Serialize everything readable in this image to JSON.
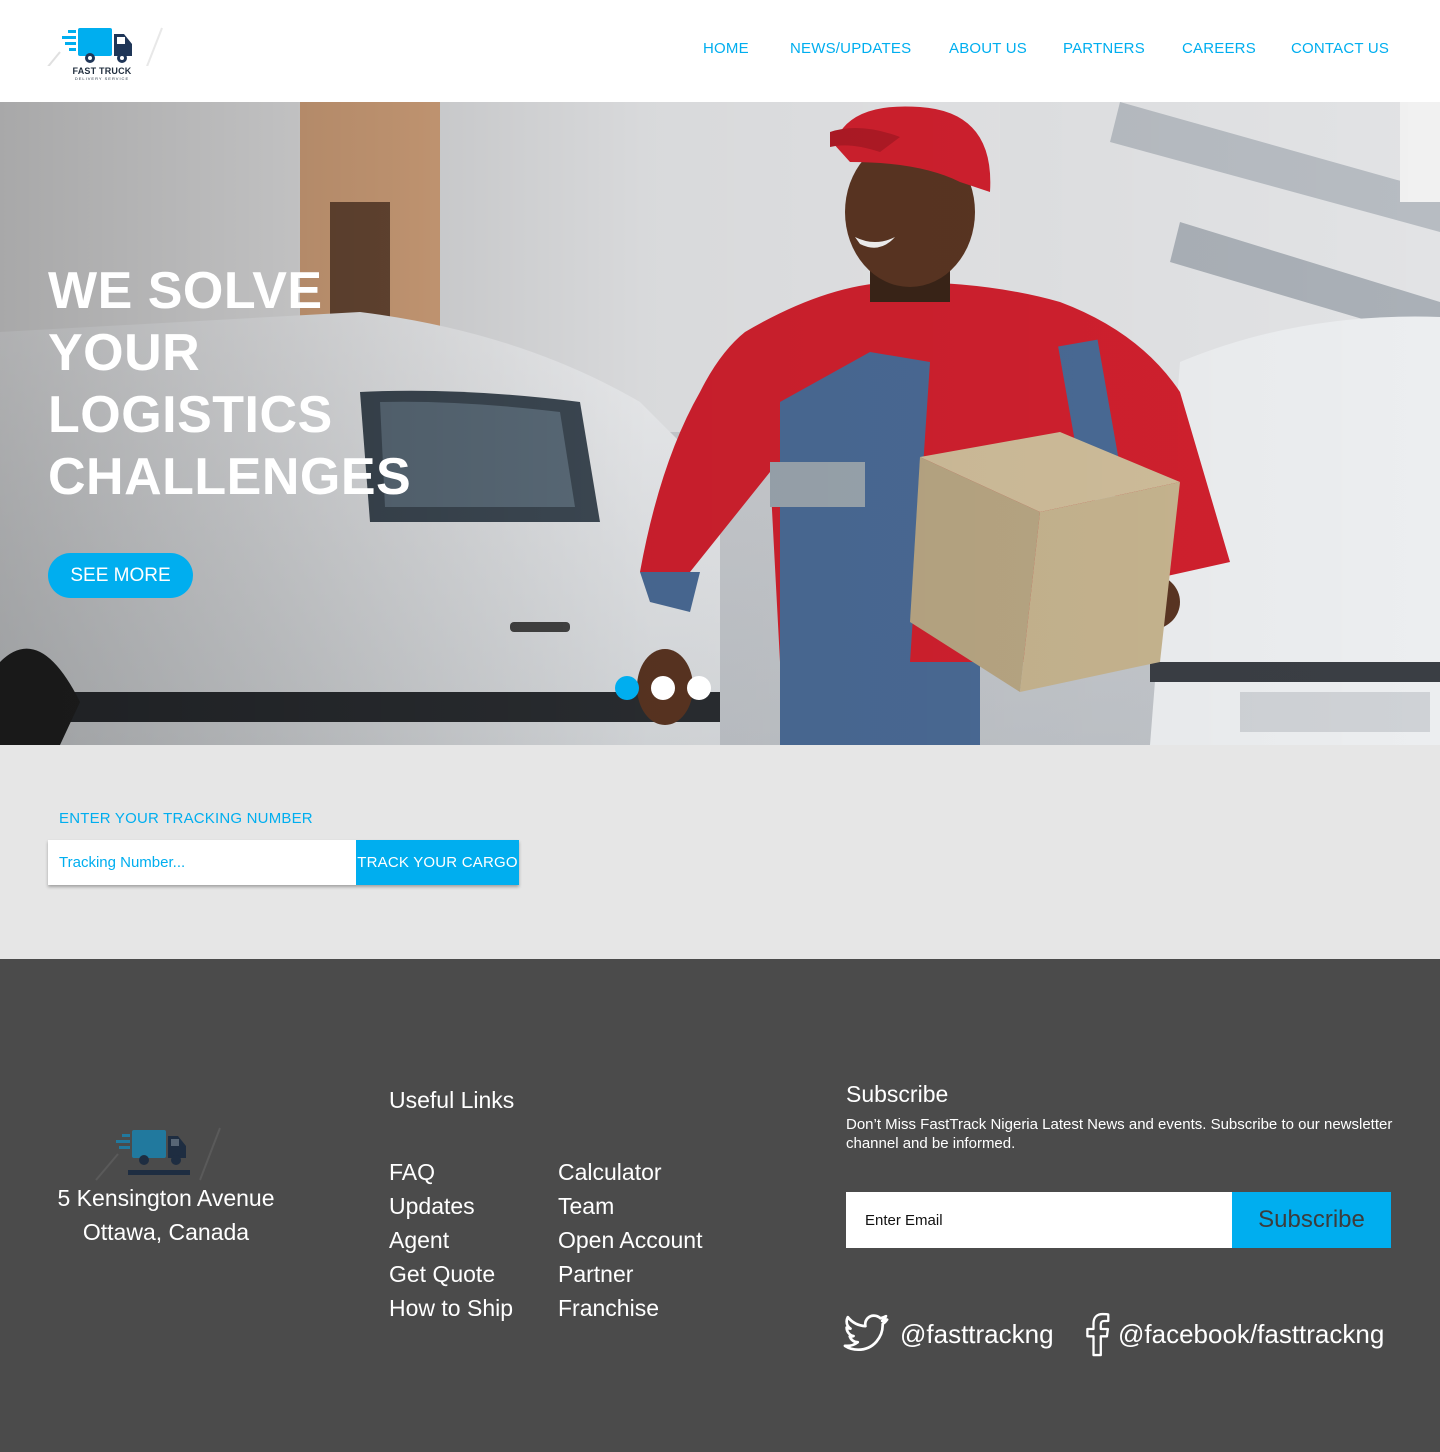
{
  "header": {
    "logo": {
      "name": "FAST TRUCK",
      "tagline": "DELIVERY SERVICE"
    },
    "nav": [
      {
        "label": "HOME"
      },
      {
        "label": "NEWS/UPDATES"
      },
      {
        "label": "ABOUT US"
      },
      {
        "label": "PARTNERS"
      },
      {
        "label": "CAREERS"
      },
      {
        "label": "CONTACT  US"
      }
    ]
  },
  "hero": {
    "title_lines": [
      "WE SOLVE",
      "YOUR",
      "LOGISTICS",
      "CHALLENGES"
    ],
    "cta_label": "SEE MORE",
    "slides_count": 3,
    "active_slide": 1
  },
  "tracking": {
    "label": "ENTER YOUR TRACKING NUMBER",
    "placeholder": "Tracking Number...",
    "button_label": "TRACK YOUR CARGO"
  },
  "footer": {
    "address_lines": [
      "5 Kensington Avenue",
      "Ottawa, Canada"
    ],
    "links_title": "Useful Links",
    "links_col1": [
      "FAQ",
      "Updates",
      "Agent",
      "Get Quote",
      "How to Ship"
    ],
    "links_col2": [
      "Calculator",
      "Team",
      "Open Account",
      "Partner",
      "Franchise"
    ],
    "subscribe": {
      "title": "Subscribe",
      "text": "Don’t Miss FastTrack Nigeria Latest News and events. Subscribe to our newsletter channel and be informed.",
      "email_placeholder": "Enter Email",
      "button_label": "Subscribe"
    },
    "social": {
      "twitter": {
        "icon": "twitter-icon",
        "handle": "@fasttrackng"
      },
      "facebook": {
        "icon": "facebook-icon",
        "handle": "@facebook/fasttrackng"
      }
    }
  },
  "colors": {
    "accent": "#00aeef",
    "footer_bg": "#4b4b4b",
    "tracking_bg": "#e6e6e6",
    "uniform_red": "#d0202e",
    "uniform_blue": "#4a6a95"
  }
}
